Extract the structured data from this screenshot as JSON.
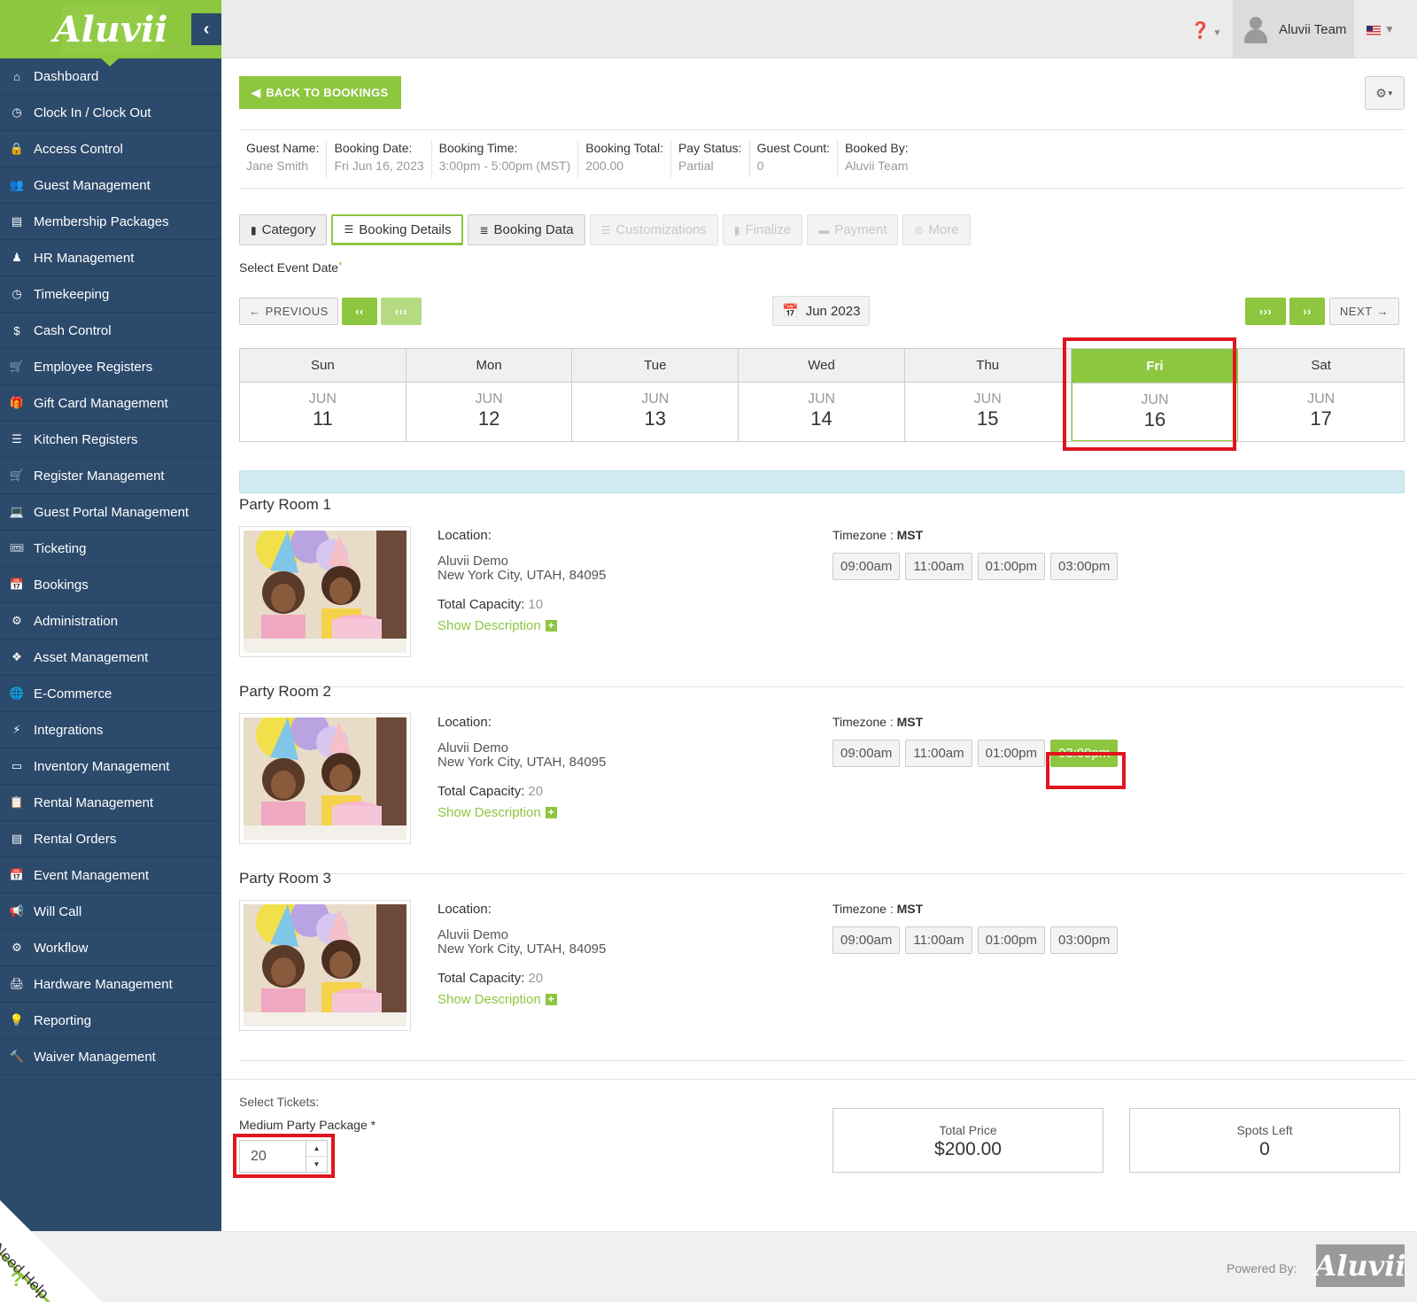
{
  "brand": {
    "logo_text": "Aluvii",
    "accent": "#8dc63f",
    "sidebar_bg": "#2c4a6b"
  },
  "sidebar": {
    "items": [
      {
        "label": "Dashboard",
        "icon": "home-icon",
        "glyph": "⌂"
      },
      {
        "label": "Clock In / Clock Out",
        "icon": "clock-icon",
        "glyph": "◷"
      },
      {
        "label": "Access Control",
        "icon": "lock-icon",
        "glyph": "🔒"
      },
      {
        "label": "Guest Management",
        "icon": "users-icon",
        "glyph": "👥"
      },
      {
        "label": "Membership Packages",
        "icon": "card-icon",
        "glyph": "▤"
      },
      {
        "label": "HR Management",
        "icon": "person-icon",
        "glyph": "♟"
      },
      {
        "label": "Timekeeping",
        "icon": "clock-icon",
        "glyph": "◷"
      },
      {
        "label": "Cash Control",
        "icon": "dollar-icon",
        "glyph": "$"
      },
      {
        "label": "Employee Registers",
        "icon": "cart-icon",
        "glyph": "🛒"
      },
      {
        "label": "Gift Card Management",
        "icon": "gift-icon",
        "glyph": "🎁"
      },
      {
        "label": "Kitchen Registers",
        "icon": "list-icon",
        "glyph": "☰"
      },
      {
        "label": "Register Management",
        "icon": "cart-icon",
        "glyph": "🛒"
      },
      {
        "label": "Guest Portal Management",
        "icon": "laptop-icon",
        "glyph": "💻"
      },
      {
        "label": "Ticketing",
        "icon": "ticket-icon",
        "glyph": "🎟"
      },
      {
        "label": "Bookings",
        "icon": "calendar-plus-icon",
        "glyph": "📅"
      },
      {
        "label": "Administration",
        "icon": "cogs-icon",
        "glyph": "⚙"
      },
      {
        "label": "Asset Management",
        "icon": "cubes-icon",
        "glyph": "❖"
      },
      {
        "label": "E-Commerce",
        "icon": "globe-icon",
        "glyph": "🌐"
      },
      {
        "label": "Integrations",
        "icon": "bolt-icon",
        "glyph": "⚡"
      },
      {
        "label": "Inventory Management",
        "icon": "archive-icon",
        "glyph": "▭"
      },
      {
        "label": "Rental Management",
        "icon": "clipboard-icon",
        "glyph": "📋"
      },
      {
        "label": "Rental Orders",
        "icon": "list-alt-icon",
        "glyph": "▤"
      },
      {
        "label": "Event Management",
        "icon": "calendar-check-icon",
        "glyph": "📅"
      },
      {
        "label": "Will Call",
        "icon": "bullhorn-icon",
        "glyph": "📢"
      },
      {
        "label": "Workflow",
        "icon": "cog-icon",
        "glyph": "⚙"
      },
      {
        "label": "Hardware Management",
        "icon": "print-icon",
        "glyph": "🖨"
      },
      {
        "label": "Reporting",
        "icon": "lightbulb-icon",
        "glyph": "💡"
      },
      {
        "label": "Waiver Management",
        "icon": "gavel-icon",
        "glyph": "🔨"
      }
    ],
    "need_help": "Need Help"
  },
  "header": {
    "user_name": "Aluvii Team"
  },
  "toolbar": {
    "back_label": "BACK TO BOOKINGS"
  },
  "summary": [
    {
      "label": "Guest Name:",
      "value": "Jane Smith"
    },
    {
      "label": "Booking Date:",
      "value": "Fri Jun 16, 2023"
    },
    {
      "label": "Booking Time:",
      "value": "3:00pm - 5:00pm (MST)"
    },
    {
      "label": "Booking Total:",
      "value": "200.00"
    },
    {
      "label": "Pay Status:",
      "value": "Partial"
    },
    {
      "label": "Guest Count:",
      "value": "0"
    },
    {
      "label": "Booked By:",
      "value": "Aluvii Team"
    }
  ],
  "tabs": [
    {
      "label": "Category",
      "state": "normal",
      "glyph": "▮"
    },
    {
      "label": "Booking Details",
      "state": "active",
      "glyph": "☰"
    },
    {
      "label": "Booking Data",
      "state": "normal",
      "glyph": "≣"
    },
    {
      "label": "Customizations",
      "state": "disabled",
      "glyph": "☰"
    },
    {
      "label": "Finalize",
      "state": "disabled",
      "glyph": "▮"
    },
    {
      "label": "Payment",
      "state": "disabled",
      "glyph": "▬"
    },
    {
      "label": "More",
      "state": "disabled",
      "glyph": "⊘"
    }
  ],
  "event_date_label": "Select Event Date",
  "calendar_nav": {
    "previous": "PREVIOUS",
    "back_one": "‹‹",
    "back_two": "‹‹‹",
    "month_label": "Jun  2023",
    "fwd_two": "›››",
    "fwd_one": "››",
    "next": "NEXT"
  },
  "week": [
    {
      "dow": "Sun",
      "mon": "JUN",
      "day": "11",
      "selected": false
    },
    {
      "dow": "Mon",
      "mon": "JUN",
      "day": "12",
      "selected": false
    },
    {
      "dow": "Tue",
      "mon": "JUN",
      "day": "13",
      "selected": false
    },
    {
      "dow": "Wed",
      "mon": "JUN",
      "day": "14",
      "selected": false
    },
    {
      "dow": "Thu",
      "mon": "JUN",
      "day": "15",
      "selected": false
    },
    {
      "dow": "Fri",
      "mon": "JUN",
      "day": "16",
      "selected": true
    },
    {
      "dow": "Sat",
      "mon": "JUN",
      "day": "17",
      "selected": false
    }
  ],
  "rooms": [
    {
      "title": "Party Room 1",
      "location_label": "Location:",
      "location_line1": "Aluvii Demo",
      "location_line2": "New York City, UTAH, 84095",
      "capacity_label": "Total Capacity:",
      "capacity": "10",
      "show_desc": "Show Description",
      "tz_label": "Timezone : ",
      "tz": "MST",
      "slots": [
        {
          "t": "09:00am",
          "sel": false
        },
        {
          "t": "11:00am",
          "sel": false
        },
        {
          "t": "01:00pm",
          "sel": false
        },
        {
          "t": "03:00pm",
          "sel": false
        }
      ]
    },
    {
      "title": "Party Room 2",
      "location_label": "Location:",
      "location_line1": "Aluvii Demo",
      "location_line2": "New York City, UTAH, 84095",
      "capacity_label": "Total Capacity:",
      "capacity": "20",
      "show_desc": "Show Description",
      "tz_label": "Timezone : ",
      "tz": "MST",
      "slots": [
        {
          "t": "09:00am",
          "sel": false
        },
        {
          "t": "11:00am",
          "sel": false
        },
        {
          "t": "01:00pm",
          "sel": false
        },
        {
          "t": "03:00pm",
          "sel": true
        }
      ]
    },
    {
      "title": "Party Room 3",
      "location_label": "Location:",
      "location_line1": "Aluvii Demo",
      "location_line2": "New York City, UTAH, 84095",
      "capacity_label": "Total Capacity:",
      "capacity": "20",
      "show_desc": "Show Description",
      "tz_label": "Timezone : ",
      "tz": "MST",
      "slots": [
        {
          "t": "09:00am",
          "sel": false
        },
        {
          "t": "11:00am",
          "sel": false
        },
        {
          "t": "01:00pm",
          "sel": false
        },
        {
          "t": "03:00pm",
          "sel": false
        }
      ]
    }
  ],
  "tickets": {
    "select_label": "Select Tickets:",
    "package_label": "Medium Party Package *",
    "quantity": "20",
    "total_price_label": "Total Price",
    "total_price": "$200.00",
    "spots_left_label": "Spots Left",
    "spots_left": "0"
  },
  "footer": {
    "powered_by": "Powered By:",
    "logo_text": "Aluvii"
  }
}
